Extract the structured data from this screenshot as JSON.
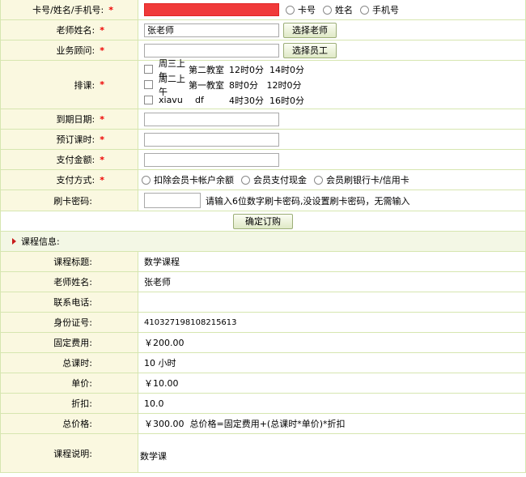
{
  "form": {
    "member": {
      "label": "卡号/姓名/手机号:",
      "value": "",
      "options": [
        "卡号",
        "姓名",
        "手机号"
      ]
    },
    "teacher": {
      "label": "老师姓名:",
      "value": "张老师",
      "button": "选择老师"
    },
    "consultant": {
      "label": "业务顾问:",
      "value": "",
      "button": "选择员工"
    },
    "schedule": {
      "label": "排课:",
      "items": [
        {
          "day": "周三上午",
          "room": "第二教室",
          "time": "12时0分  14时0分"
        },
        {
          "day": "周二上午",
          "room": "第一教室",
          "time": "8时0分   12时0分"
        },
        {
          "day": "xiavu",
          "room": "df",
          "time": "4时30分  16时0分"
        }
      ]
    },
    "expire": {
      "label": "到期日期:",
      "value": ""
    },
    "hours": {
      "label": "预订课时:",
      "value": ""
    },
    "amount": {
      "label": "支付金额:",
      "value": ""
    },
    "payment": {
      "label": "支付方式:",
      "options": [
        "扣除会员卡帐户余额",
        "会员支付现金",
        "会员刷银行卡/信用卡"
      ]
    },
    "card_pwd": {
      "label": "刷卡密码:",
      "value": "",
      "hint": "请输入6位数字刷卡密码,没设置刷卡密码，无需输入"
    },
    "submit": "确定订购"
  },
  "course": {
    "section_title": "课程信息:",
    "rows": [
      {
        "label": "课程标题:",
        "value": "数学课程"
      },
      {
        "label": "老师姓名:",
        "value": "张老师"
      },
      {
        "label": "联系电话:",
        "value": ""
      },
      {
        "label": "身份证号:",
        "value": "410327198108215613"
      },
      {
        "label": "固定费用:",
        "value": "￥200.00"
      },
      {
        "label": "总课时:",
        "value": "10 小时"
      },
      {
        "label": "单价:",
        "value": "￥10.00"
      },
      {
        "label": "折扣:",
        "value": "10.0"
      },
      {
        "label": "总价格:",
        "value": "￥300.00  总价格=固定费用+(总课时*单价)*折扣"
      },
      {
        "label": "课程说明:",
        "value": "数学课"
      }
    ]
  },
  "colors": {
    "highlight_input": "#f03a3a",
    "label_bg": "#faf8e0",
    "border": "#d6e6b0",
    "required": "#e00000"
  }
}
